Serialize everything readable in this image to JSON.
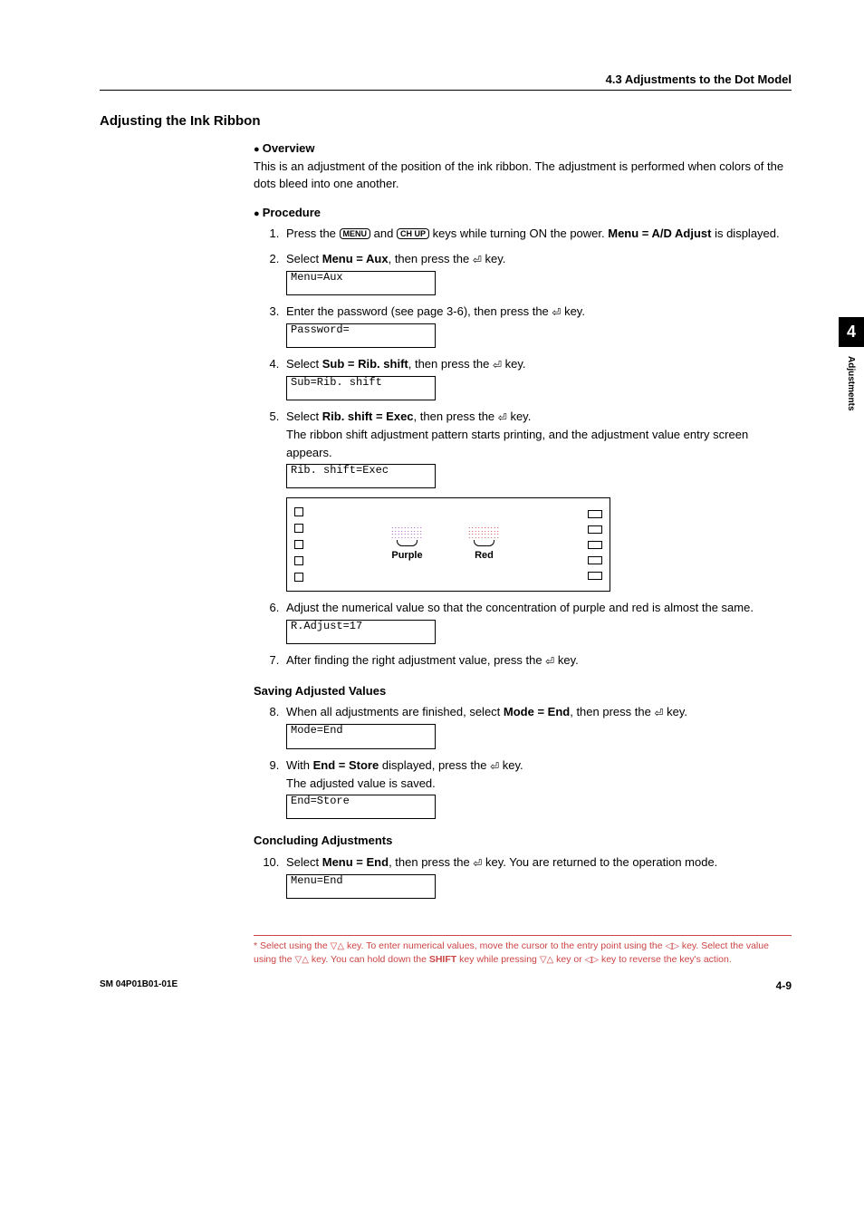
{
  "header": {
    "breadcrumb": "4.3  Adjustments to the Dot Model"
  },
  "sidetab": {
    "number": "4",
    "label": "Adjustments"
  },
  "title": "Adjusting the Ink Ribbon",
  "overview": {
    "head": "Overview",
    "text": "This is an adjustment of the position of the ink ribbon.  The adjustment is performed when colors of the dots bleed into one another."
  },
  "procedure": {
    "head": "Procedure",
    "s1_a": "Press the ",
    "s1_key1": "MENU",
    "s1_b": " and ",
    "s1_key2": "CH UP",
    "s1_c": " keys while turning ON the power.  ",
    "s1_bold": "Menu = A/D Adjust",
    "s1_d": " is displayed.",
    "s2_a": "Select ",
    "s2_bold": "Menu = Aux",
    "s2_b": ", then press the ",
    "s2_c": " key.",
    "s2_lcd": "Menu=Aux",
    "s3_a": "Enter the password (see page 3-6), then press the ",
    "s3_b": " key.",
    "s3_lcd": "Password=",
    "s4_a": "Select ",
    "s4_bold": "Sub = Rib. shift",
    "s4_b": ", then press the ",
    "s4_c": " key.",
    "s4_lcd": "Sub=Rib. shift",
    "s5_a": "Select ",
    "s5_bold": "Rib. shift = Exec",
    "s5_b": ", then press the ",
    "s5_c": " key.",
    "s5_d": "The ribbon shift adjustment pattern starts printing, and the adjustment value entry screen appears.",
    "s5_lcd": "Rib. shift=Exec",
    "pattern": {
      "purple": "Purple",
      "red": "Red"
    },
    "s6_a": "Adjust the numerical value so that the concentration of purple and red is almost the same.",
    "s6_lcd": "R.Adjust=17",
    "s7_a": "After finding the right adjustment value, press the ",
    "s7_b": " key."
  },
  "saving": {
    "head": "Saving Adjusted Values",
    "s8_a": "When all adjustments are finished, select ",
    "s8_bold": "Mode = End",
    "s8_b": ", then press the ",
    "s8_c": " key.",
    "s8_lcd": "Mode=End",
    "s9_a": "With ",
    "s9_bold": "End = Store",
    "s9_b": " displayed, press the ",
    "s9_c": " key.",
    "s9_d": "The adjusted value is saved.",
    "s9_lcd": "End=Store"
  },
  "concluding": {
    "head": "Concluding Adjustments",
    "s10_a": "Select ",
    "s10_bold": "Menu = End",
    "s10_b": ", then press the ",
    "s10_c": " key.  You are returned to the operation mode.",
    "s10_lcd": "Menu=End"
  },
  "footnote": {
    "a": "Select using the ",
    "b": " key.  To enter numerical values, move the cursor to the entry point using the ",
    "c": " key.  Select the value using the  ",
    "d": " key.  You can hold down the ",
    "shift": "SHIFT",
    "e": " key while pressing ",
    "f": " key or ",
    "g": " key to reverse the key's action."
  },
  "footer": {
    "left": "SM 04P01B01-01E",
    "right": "4-9"
  }
}
